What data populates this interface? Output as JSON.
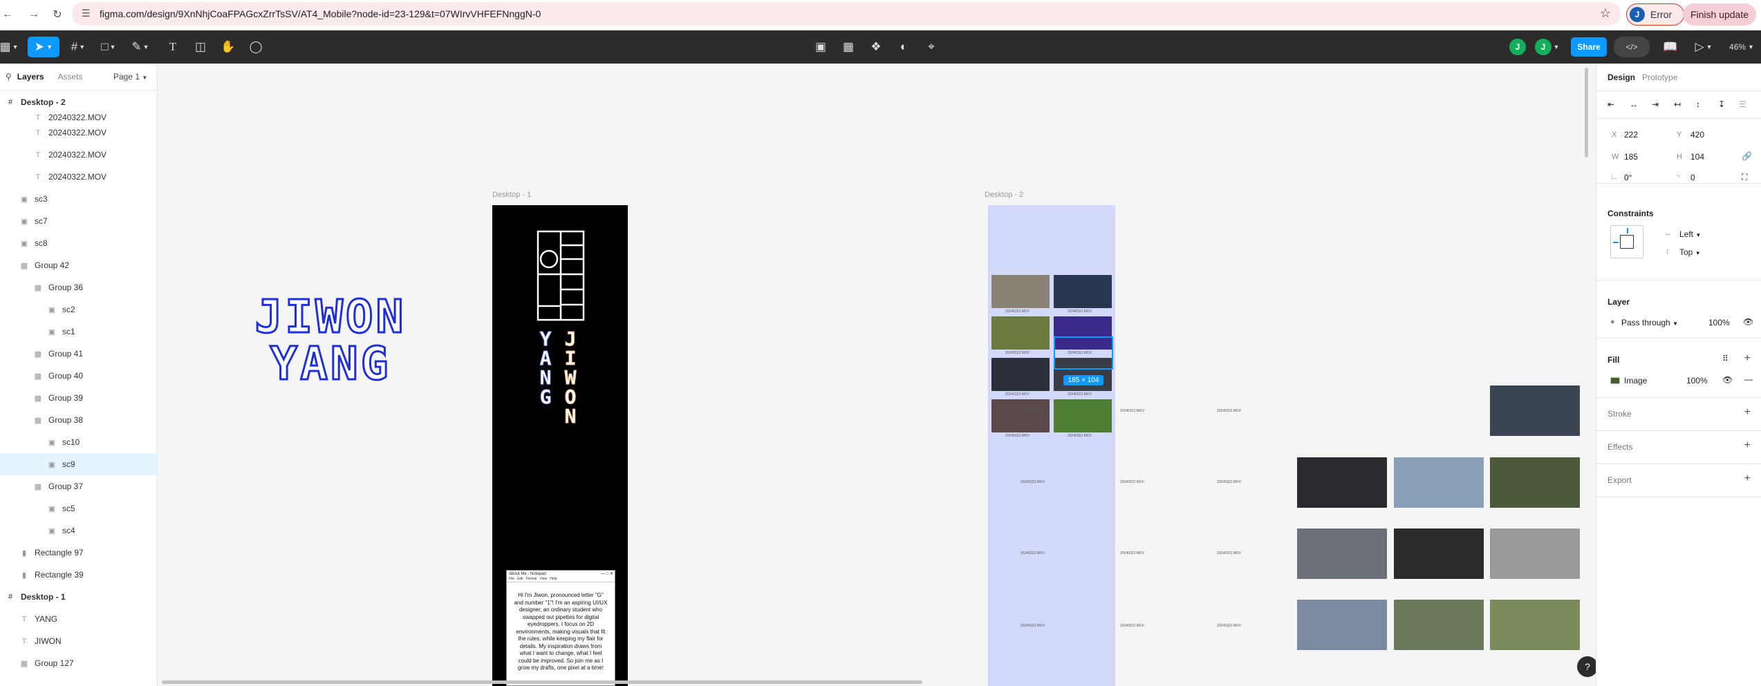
{
  "browser": {
    "url": "figma.com/design/9XnNhjCoaFPAGcxZrrTsSV/AT4_Mobile?node-id=23-129&t=07WIrvVHFEFNnggN-0",
    "error_label": "Error",
    "avatar_letter": "J",
    "finish_update_label": "Finish update"
  },
  "toolbar": {
    "share_label": "Share",
    "zoom": "46%",
    "collaborators": [
      "J",
      "J"
    ]
  },
  "left_panel": {
    "tabs": [
      "Layers",
      "Assets"
    ],
    "page": "Page 1",
    "layers": [
      {
        "name": "Desktop - 2",
        "indent": 0,
        "icon": "frame",
        "bold": true
      },
      {
        "name": "20240322.MOV",
        "indent": 2,
        "icon": "text",
        "partial": true
      },
      {
        "name": "20240322.MOV",
        "indent": 2,
        "icon": "text"
      },
      {
        "name": "20240322.MOV",
        "indent": 2,
        "icon": "text"
      },
      {
        "name": "20240322.MOV",
        "indent": 2,
        "icon": "text"
      },
      {
        "name": "sc3",
        "indent": 1,
        "icon": "image"
      },
      {
        "name": "sc7",
        "indent": 1,
        "icon": "image"
      },
      {
        "name": "sc8",
        "indent": 1,
        "icon": "image"
      },
      {
        "name": "Group 42",
        "indent": 1,
        "icon": "group"
      },
      {
        "name": "Group 36",
        "indent": 2,
        "icon": "group"
      },
      {
        "name": "sc2",
        "indent": 3,
        "icon": "image"
      },
      {
        "name": "sc1",
        "indent": 3,
        "icon": "image"
      },
      {
        "name": "Group 41",
        "indent": 2,
        "icon": "group"
      },
      {
        "name": "Group 40",
        "indent": 2,
        "icon": "group"
      },
      {
        "name": "Group 39",
        "indent": 2,
        "icon": "group"
      },
      {
        "name": "Group 38",
        "indent": 2,
        "icon": "group"
      },
      {
        "name": "sc10",
        "indent": 3,
        "icon": "image"
      },
      {
        "name": "sc9",
        "indent": 3,
        "icon": "image",
        "selected": true
      },
      {
        "name": "Group 37",
        "indent": 2,
        "icon": "group"
      },
      {
        "name": "sc5",
        "indent": 3,
        "icon": "image"
      },
      {
        "name": "sc4",
        "indent": 3,
        "icon": "image"
      },
      {
        "name": "Rectangle 97",
        "indent": 1,
        "icon": "rect"
      },
      {
        "name": "Rectangle 39",
        "indent": 1,
        "icon": "rect"
      },
      {
        "name": "Desktop - 1",
        "indent": 0,
        "icon": "frame",
        "bold": true
      },
      {
        "name": "YANG",
        "indent": 1,
        "icon": "text"
      },
      {
        "name": "JIWON",
        "indent": 1,
        "icon": "text"
      },
      {
        "name": "Group 127",
        "indent": 1,
        "icon": "group"
      }
    ]
  },
  "canvas": {
    "frame1_label": "Desktop - 1",
    "frame2_label": "Desktop - 2",
    "big_word_1": "JIWON",
    "big_word_2": "YANG",
    "vertical_word_1": "YANG",
    "vertical_word_2": "JIWON",
    "selection_size": "185 × 104",
    "notepad_title": "About Me - Notepad",
    "notepad_menu": [
      "File",
      "Edit",
      "Format",
      "View",
      "Help"
    ],
    "notepad_text": "Hi I'm Jiwon, pronounced letter \"G\" and number \"1\"! I'm an aspiring UI/UX designer, an ordinary student who swapped out pipettes for digital eyedroppers. I focus on 2D environments, making visuals that fit the rules, while keeping my flair for details. My inspiration draws from what I want to change, what I feel could be improved. So join me as I grow my drafts, one pixel at a time!",
    "thumb_label": "20240322.MOV"
  },
  "right_panel": {
    "tabs": [
      "Design",
      "Prototype"
    ],
    "x_label": "X",
    "x": "222",
    "y_label": "Y",
    "y": "420",
    "w_label": "W",
    "w": "185",
    "h_label": "H",
    "h": "104",
    "rotation": "0°",
    "radius": "0",
    "constraints_title": "Constraints",
    "constraint_h": "Left",
    "constraint_v": "Top",
    "layer_title": "Layer",
    "blend": "Pass through",
    "layer_opacity": "100%",
    "fill_title": "Fill",
    "fill_type": "Image",
    "fill_opacity": "100%",
    "stroke_title": "Stroke",
    "effects_title": "Effects",
    "export_title": "Export"
  },
  "colors": {
    "accent": "#0d99ff",
    "pixel_text_blue": "#1f2fd6",
    "selection_fill": "#d3d9fb"
  }
}
